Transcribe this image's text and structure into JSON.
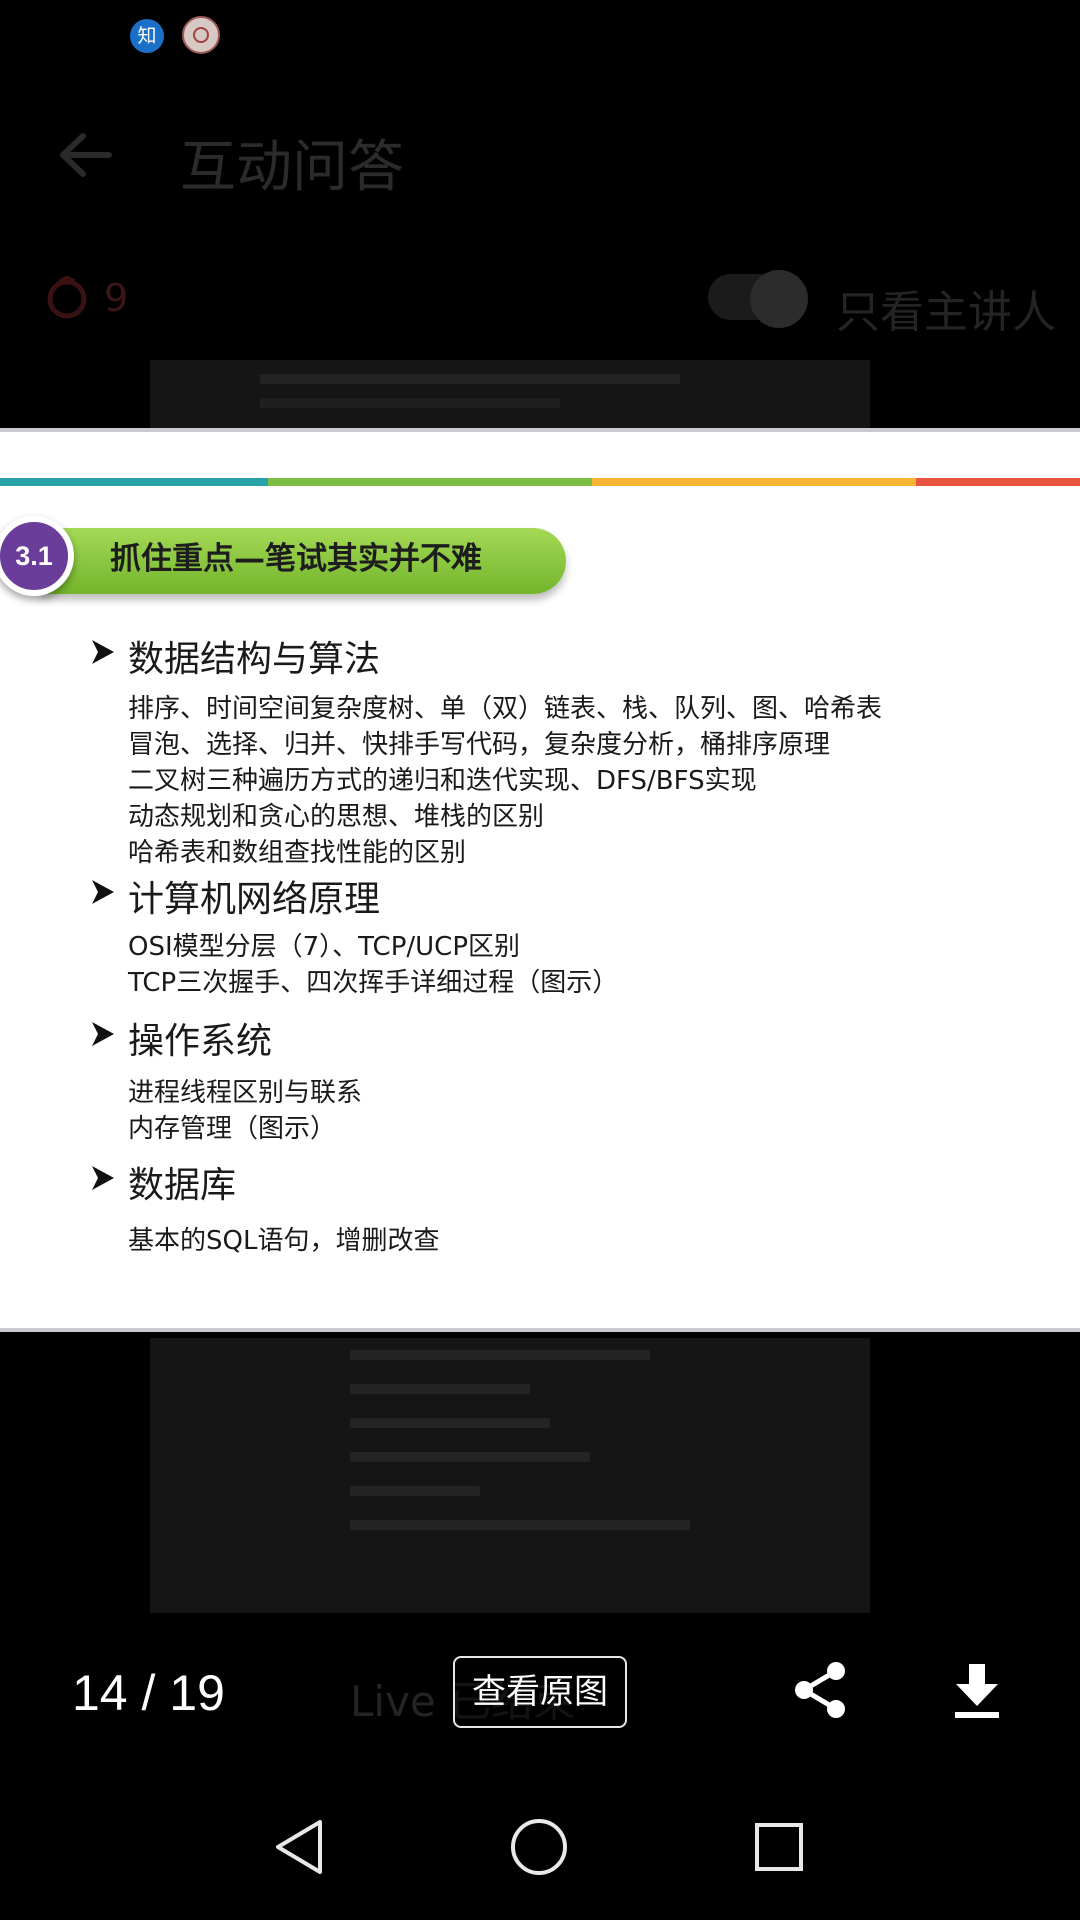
{
  "status_bar": {
    "zhihu_icon_text": "知"
  },
  "background": {
    "title": "互动问答",
    "like_count": "9",
    "speaker_only_label": "只看主讲人",
    "bottom_text": "Live 已结束"
  },
  "slide": {
    "badge": "3.1",
    "banner_title": "抓住重点—笔试其实并不难",
    "sections": [
      {
        "title": "数据结构与算法",
        "items": [
          "排序、时间空间复杂度树、单（双）链表、栈、队列、图、哈希表",
          "冒泡、选择、归并、快排手写代码，复杂度分析，桶排序原理",
          "二叉树三种遍历方式的递归和迭代实现、DFS/BFS实现",
          "动态规划和贪心的思想、堆栈的区别",
          "哈希表和数组查找性能的区别"
        ]
      },
      {
        "title": "计算机网络原理",
        "items": [
          "OSI模型分层（7）、TCP/UCP区别",
          "TCP三次握手、四次挥手详细过程（图示）"
        ]
      },
      {
        "title": "操作系统",
        "items": [
          "进程线程区别与联系",
          "内存管理（图示）"
        ]
      },
      {
        "title": "数据库",
        "items": [
          "基本的SQL语句，增删改查"
        ]
      }
    ],
    "stripe_colors": [
      "#28a3a8",
      "#7cbd42",
      "#f4b537",
      "#e8543e"
    ],
    "badge_color": "#6a3d9a",
    "banner_color": "#8cc63f"
  },
  "viewer": {
    "page_counter": "14 / 19",
    "view_original_label": "查看原图",
    "share_icon": "share-icon",
    "download_icon": "download-icon"
  },
  "nav": {
    "back_icon": "nav-back-icon",
    "home_icon": "nav-home-icon",
    "recent_icon": "nav-recent-icon"
  }
}
